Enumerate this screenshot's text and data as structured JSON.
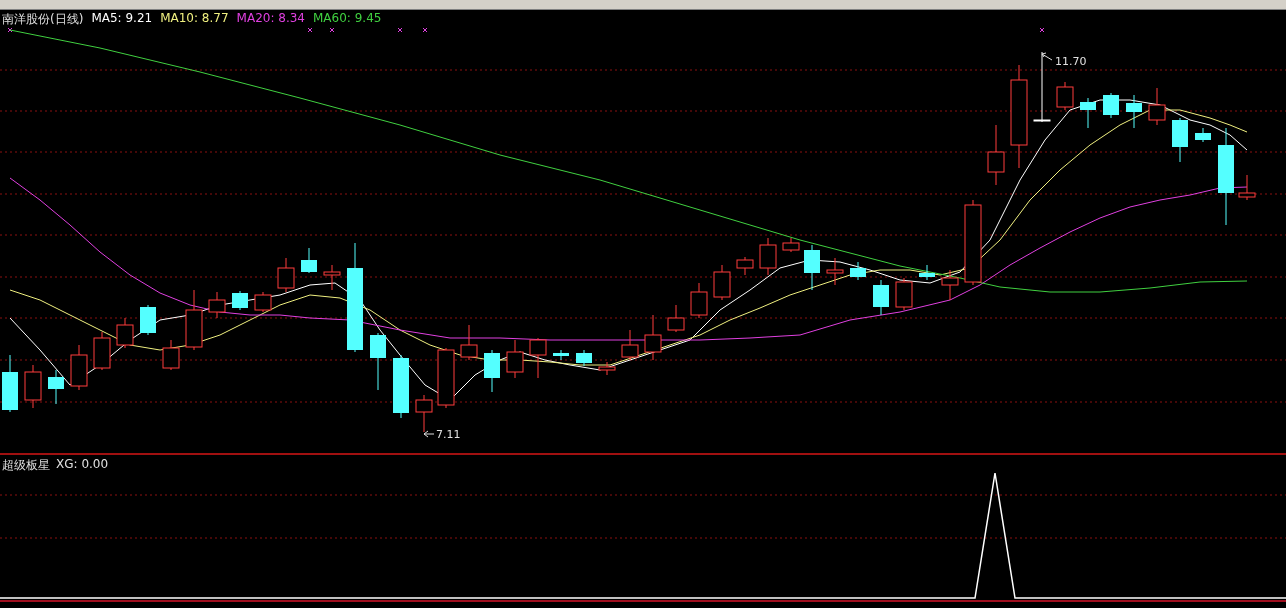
{
  "legend": {
    "stock": "南洋股份(日线)",
    "ma": [
      {
        "label": "MA5: 9.21",
        "color": "#ffffff"
      },
      {
        "label": "MA10: 8.77",
        "color": "#f0f080"
      },
      {
        "label": "MA20: 8.34",
        "color": "#e040e0"
      },
      {
        "label": "MA60: 9.45",
        "color": "#40d040"
      }
    ]
  },
  "price_marks": {
    "high": "11.70",
    "low": "7.11"
  },
  "indicator": {
    "name": "超级板星",
    "reading": "XG: 0.00"
  }
}
